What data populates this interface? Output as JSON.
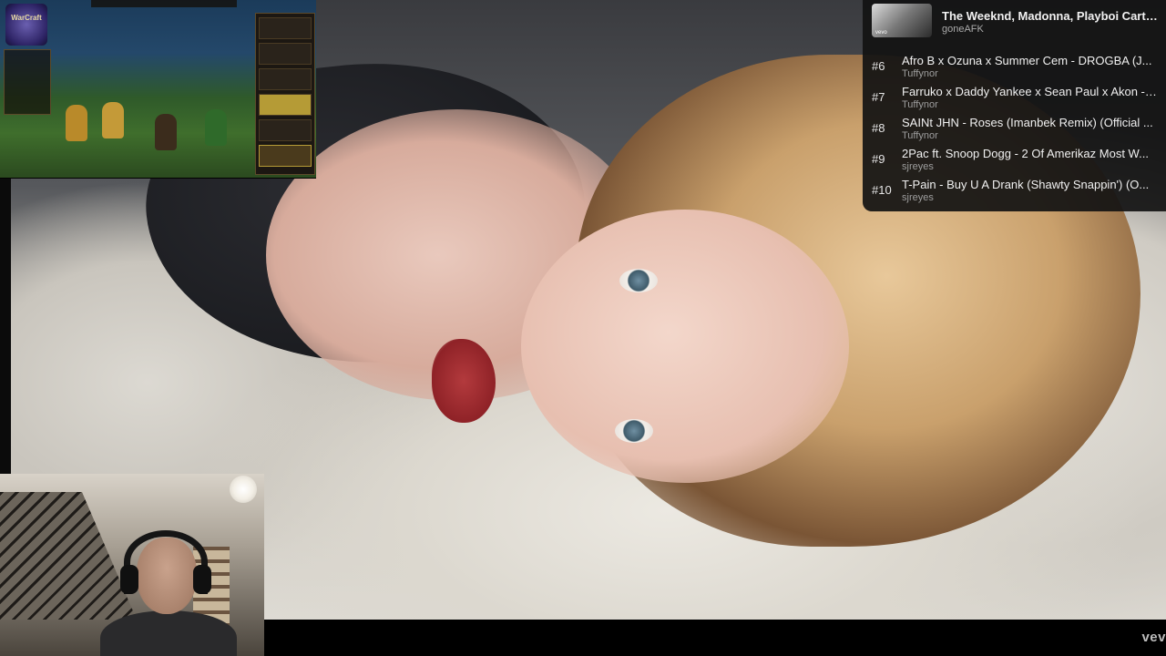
{
  "video": {
    "watermark": "vev"
  },
  "game_overlay": {
    "logo_text": "WarCraft"
  },
  "playlist": {
    "now_playing": {
      "title": "The Weeknd, Madonna, Playboi Carti ...",
      "channel": "goneAFK",
      "thumb_mark": "vevo"
    },
    "items": [
      {
        "rank": "#6",
        "title": "Afro B x Ozuna x Summer Cem - DROGBA (J...",
        "artist": "Tuffynor"
      },
      {
        "rank": "#7",
        "title": "Farruko x Daddy Yankee x Sean Paul x Akon - ...",
        "artist": "Tuffynor"
      },
      {
        "rank": "#8",
        "title": "SAINt JHN - Roses (Imanbek Remix) (Official ...",
        "artist": "Tuffynor"
      },
      {
        "rank": "#9",
        "title": "2Pac ft. Snoop Dogg - 2 Of Amerikaz Most W...",
        "artist": "sjreyes"
      },
      {
        "rank": "#10",
        "title": "T-Pain - Buy U A Drank (Shawty Snappin') (O...",
        "artist": "sjreyes"
      }
    ]
  },
  "colors": {
    "panel_bg": "#121212",
    "text_primary": "#f1f1f1",
    "text_secondary": "#9e9e9e"
  }
}
